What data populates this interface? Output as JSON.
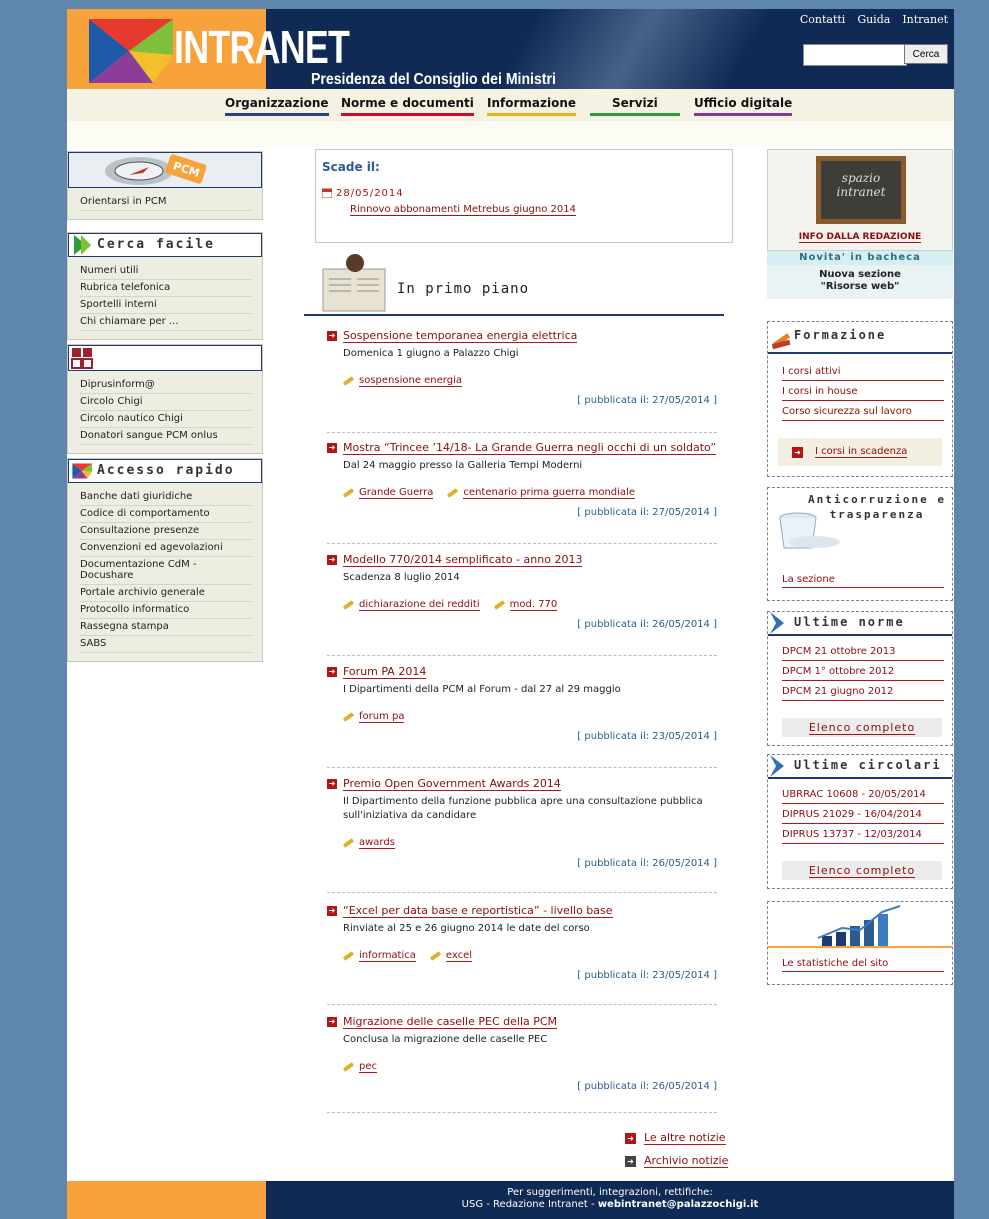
{
  "header": {
    "logo_text_a": "INTRA",
    "logo_text_b": "NET",
    "subtitle": "Presidenza del Consiglio dei Ministri",
    "top_links": [
      "Contatti",
      "Guida",
      "Intranet"
    ],
    "search_button": "Cerca",
    "search_value": ""
  },
  "nav": {
    "items": [
      {
        "label": "Organizzazione",
        "color": "#2c3e8f"
      },
      {
        "label": "Norme e documenti",
        "color": "#c8102e"
      },
      {
        "label": "Informazione",
        "color": "#e8b21d"
      },
      {
        "label": "Servizi",
        "color": "#2e9b3d"
      },
      {
        "label": "Ufficio digitale",
        "color": "#7b3a96"
      }
    ]
  },
  "left": {
    "pcm_badge": "PCM",
    "orientarsi": "Orientarsi in PCM",
    "cerca_title": "Cerca facile",
    "cerca_items": [
      "Numeri utili",
      "Rubrica telefonica",
      "Sportelli interni",
      "Chi chiamare per ..."
    ],
    "misc_items": [
      "Diprusinform@",
      "Circolo Chigi",
      "Circolo nautico Chigi",
      "Donatori sangue PCM onlus"
    ],
    "accesso_title": "Accesso rapido",
    "accesso_items": [
      "Banche dati giuridiche",
      "Codice di comportamento",
      "Consultazione presenze",
      "Convenzioni ed agevolazioni",
      "Documentazione CdM - Docushare",
      "Portale archivio generale",
      "Protocollo informatico",
      "Rassegna stampa",
      "SABS"
    ]
  },
  "scade": {
    "title": "Scade il:",
    "date": "28/05/2014",
    "link": "Rinnovo abbonamenti Metrebus giugno 2014"
  },
  "primo_piano": {
    "title": "In primo piano",
    "news": [
      {
        "title": "Sospensione temporanea energia elettrica",
        "summary": "Domenica 1 giugno a Palazzo Chigi",
        "tags": [
          "sospensione energia"
        ],
        "published": "[ pubblicata il: 27/05/2014 ]"
      },
      {
        "title": "Mostra “Trincee ’14/18- La Grande Guerra negli occhi di un soldato”",
        "summary": "Dal 24 maggio presso la Galleria Tempi Moderni",
        "tags": [
          "Grande Guerra",
          "centenario prima guerra mondiale"
        ],
        "published": "[ pubblicata il: 27/05/2014 ]"
      },
      {
        "title": "Modello 770/2014 semplificato - anno 2013",
        "summary": "Scadenza 8 luglio 2014",
        "tags": [
          "dichiarazione dei redditi",
          "mod. 770"
        ],
        "published": "[ pubblicata il: 26/05/2014 ]"
      },
      {
        "title": "Forum PA 2014",
        "summary": "I Dipartimenti della PCM al Forum - dal 27 al 29 maggio",
        "tags": [
          "forum pa"
        ],
        "published": "[ pubblicata il: 23/05/2014 ]"
      },
      {
        "title": "Premio Open Government Awards 2014",
        "summary": "Il Dipartimento della funzione pubblica apre una consultazione pubblica sull'iniziativa da candidare",
        "tags": [
          "awards"
        ],
        "published": "[ pubblicata il: 26/05/2014 ]"
      },
      {
        "title": "“Excel per data base e reportistica” - livello base",
        "summary": "Rinviate al 25 e 26 giugno 2014 le date del corso",
        "tags": [
          "informatica",
          "excel"
        ],
        "published": "[ pubblicata il: 23/05/2014 ]"
      },
      {
        "title": "Migrazione delle caselle PEC della PCM",
        "summary": "Conclusa la migrazione delle caselle PEC",
        "tags": [
          "pec"
        ],
        "published": "[ pubblicata il: 26/05/2014 ]"
      }
    ],
    "more_news": "Le altre notizie",
    "archive": "Archivio notizie"
  },
  "right": {
    "spazio_board": "spazio intranet",
    "info_redazione": "INFO DALLA REDAZIONE",
    "novita": "Novita' in bacheca",
    "nuova_line1": "Nuova sezione",
    "nuova_line2": "\"Risorse web\"",
    "formazione_title": "Formazione",
    "formazione_items": [
      "I corsi attivi",
      "I corsi in house",
      "Corso sicurezza sul lavoro"
    ],
    "corsi_scadenza": "I corsi in scadenza",
    "anticorruzione_title_1": "Anticorruzione e",
    "anticorruzione_title_2": "trasparenza",
    "anticorruzione_link": "La sezione",
    "norme_title": "Ultime norme",
    "norme_items": [
      "DPCM 21 ottobre 2013",
      "DPCM 1° ottobre 2012",
      "DPCM 21 giugno 2012"
    ],
    "norme_elenco": "Elenco completo",
    "circolari_title": "Ultime circolari",
    "circolari_items": [
      "UBRRAC 10608 - 20/05/2014",
      "DIPRUS 21029 - 16/04/2014",
      "DIPRUS 13737 - 12/03/2014"
    ],
    "circolari_elenco": "Elenco completo",
    "statistiche": "Le statistiche del sito"
  },
  "footer": {
    "line1": "Per suggerimenti, integrazioni, rettifiche:",
    "line2a": "USG - Redazione Intranet - ",
    "line2b": "webintranet@palazzochigi.it"
  }
}
